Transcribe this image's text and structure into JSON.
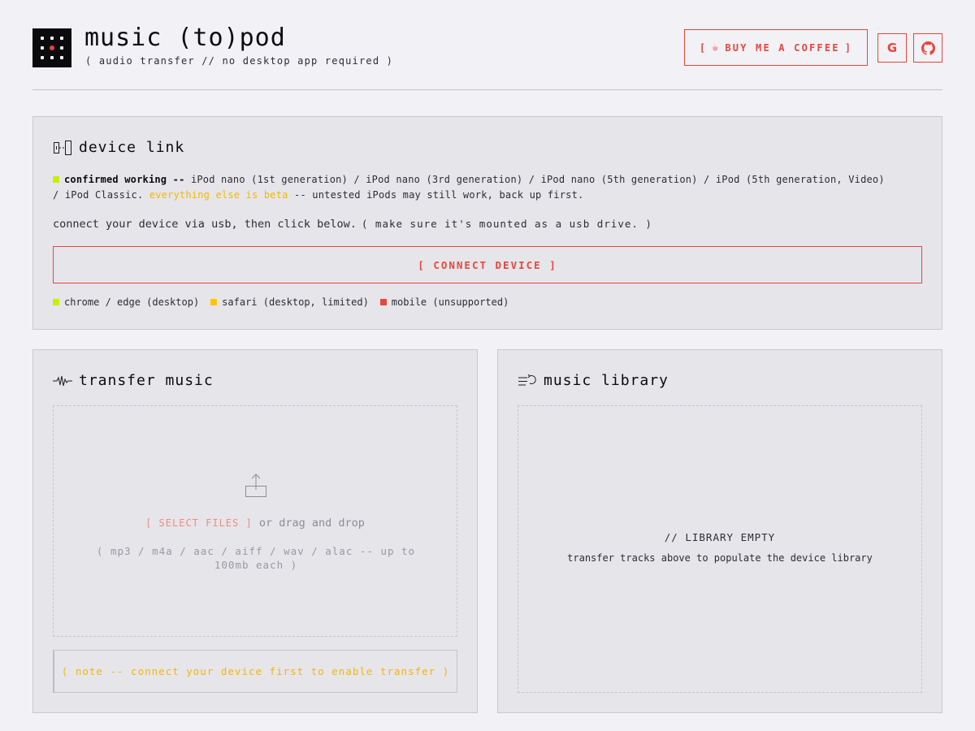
{
  "header": {
    "title": "music (to)pod",
    "subtitle": "( audio transfer // no desktop app required )",
    "coffee_button": {
      "open": "[",
      "icon": "coffee-icon",
      "label": "BUY ME A COFFEE",
      "close": "]"
    },
    "google_button": {
      "icon": "google-icon",
      "glyph": "G"
    },
    "github_button": {
      "icon": "github-icon"
    }
  },
  "device_link": {
    "heading": "device link",
    "icon": "device-link-icon",
    "compat": {
      "label": "confirmed working --",
      "devices": "iPod nano (1st generation) / iPod nano (3rd generation) / iPod nano (5th generation) / iPod (5th generation, Video) / iPod Classic.",
      "beta_label": "everything else is beta",
      "beta_note": "-- untested iPods may still work, back up first."
    },
    "instruction": "connect your device via usb, then click below.",
    "instruction_note": "( make sure it's mounted as a usb drive. )",
    "connect_button": "[ CONNECT DEVICE ]",
    "browsers": [
      {
        "label": "chrome / edge (desktop)",
        "status": "supported",
        "color": "#c8f000"
      },
      {
        "label": "safari (desktop, limited)",
        "status": "limited",
        "color": "#ffc400"
      },
      {
        "label": "mobile (unsupported)",
        "status": "unsupported",
        "color": "#e8453c"
      }
    ]
  },
  "transfer": {
    "heading": "transfer music",
    "icon": "waveform-icon",
    "upload_icon": "upload-icon",
    "select_files": "[ SELECT FILES ]",
    "drag_text": "or drag and drop",
    "formats": "( mp3 / m4a / aac / aiff / wav / alac -- up to 100mb each )",
    "note": "( note -- connect your device first to enable transfer )"
  },
  "library": {
    "heading": "music library",
    "icon": "playlist-icon",
    "empty_title": "// LIBRARY EMPTY",
    "empty_sub": "transfer tracks above to populate the device library"
  },
  "colors": {
    "accent": "#e8453c",
    "warning": "#f2b705",
    "ok": "#c8f000",
    "background": "#f2f1f6",
    "panel": "#e6e5ea"
  }
}
